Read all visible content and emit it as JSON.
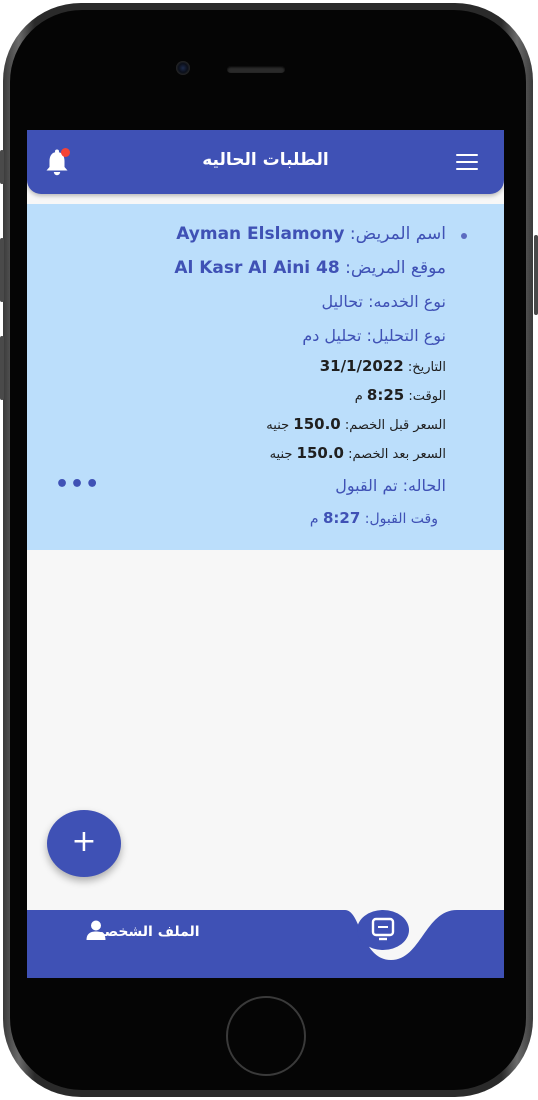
{
  "header": {
    "title": "الطلبات الحاليه"
  },
  "order": {
    "patient_name_label": "اسم المريض: ",
    "patient_name": "Ayman Elslamony",
    "patient_location_label": "موقع المريض: ",
    "patient_location": "Al Kasr Al Aini 48",
    "service_type": "نوع الخدمه: تحاليل",
    "analysis_type": "نوع التحليل: تحليل دم",
    "date_label": "التاريخ: ",
    "date": "31/1/2022",
    "time_label": "الوقت: ",
    "time_value": "8:25",
    "time_suffix": " م",
    "price_before_label": "السعر قبل الخصم: ",
    "price_before": "150.0",
    "price_before_currency": " جنيه",
    "price_after_label": "السعر بعد الخصم: ",
    "price_after": "150.0",
    "price_after_currency": " جنيه",
    "status": "الحاله: تم القبول",
    "accept_time_label": "وقت القبول: ",
    "accept_time": "8:27",
    "accept_time_suffix": " م",
    "more_label": "•••"
  },
  "fab": {
    "label": "+"
  },
  "bottom_nav": {
    "profile_label": "الملف الشخصى"
  },
  "colors": {
    "primary": "#3f51b5",
    "card_bg": "#bbdefb",
    "notification_dot": "#f44336"
  },
  "icons": [
    "bell-icon",
    "menu-icon",
    "person-icon",
    "monitor-icon"
  ]
}
